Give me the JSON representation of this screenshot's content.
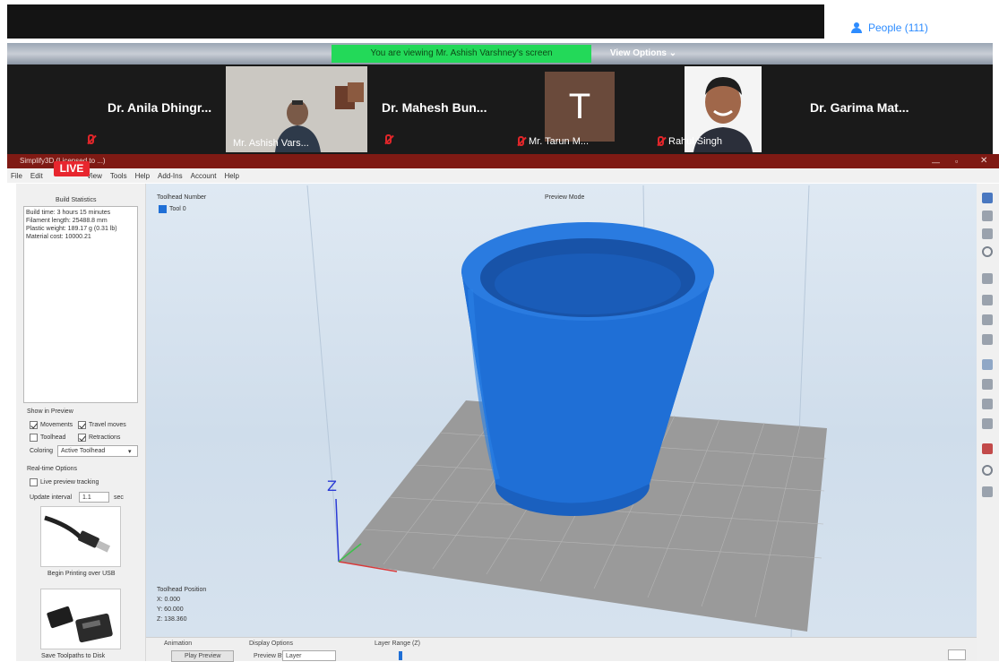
{
  "zoom": {
    "people_button": "People (111)",
    "viewing_banner": "You are viewing Mr. Ashish Varshney's screen",
    "view_options": "View Options ⌄",
    "participants": [
      {
        "name": "Dr. Anila Dhingr...",
        "muted": true
      },
      {
        "name": "Mr. Ashish Vars...",
        "muted": false
      },
      {
        "name": "Dr. Mahesh Bun...",
        "muted": true
      },
      {
        "name": "Mr. Tarun M...",
        "initial": "T",
        "muted": true
      },
      {
        "name": "Rahul Singh",
        "muted": true
      },
      {
        "name": "Dr. Garima Mat...",
        "muted": false
      }
    ],
    "live_badge": "LIVE"
  },
  "app": {
    "title": "Simplify3D (Licensed to ...)",
    "menu": [
      "File",
      "Edit",
      "View",
      "Tools",
      "Help",
      "Add-Ins",
      "Account",
      "Help"
    ],
    "left_panel": {
      "stats_title": "Build Statistics",
      "stats_lines": [
        "Build time: 3 hours 15 minutes",
        "Filament length: 25488.8 mm",
        "Plastic weight: 189.17 g (0.31 lb)",
        "Material cost: 10000.21"
      ],
      "show_in_preview": "Show in Preview",
      "cb_movements": "Movements",
      "cb_travel": "Travel moves",
      "cb_toolhead": "Toolhead",
      "cb_retractions": "Retractions",
      "coloring_label": "Coloring",
      "coloring_value": "Active Toolhead",
      "realtime_title": "Real-time Options",
      "cb_live_preview": "Live preview tracking",
      "update_interval_label": "Update interval",
      "update_interval_value": "1.1",
      "update_interval_unit": "sec",
      "usb_label": "Begin Printing over USB",
      "sd_label": "Save Toolpaths to Disk"
    },
    "viewport": {
      "toolhead_number_label": "Toolhead Number",
      "tool_label": "Tool 0",
      "preview_mode": "Preview Mode",
      "axis_z": "Z",
      "toolhead_position_label": "Toolhead Position",
      "pos_x": "X: 0.000",
      "pos_y": "Y: 60.000",
      "pos_z": "Z: 138.360",
      "object_color": "#1f6fd6",
      "bed_color": "#9a9a9a"
    },
    "bottom_panel": {
      "animation": "Animation",
      "display_options": "Display Options",
      "layer_range": "Layer Range (Z)",
      "play_button": "Play Preview",
      "preview_by": "Preview By",
      "preview_by_value": "Layer"
    }
  }
}
